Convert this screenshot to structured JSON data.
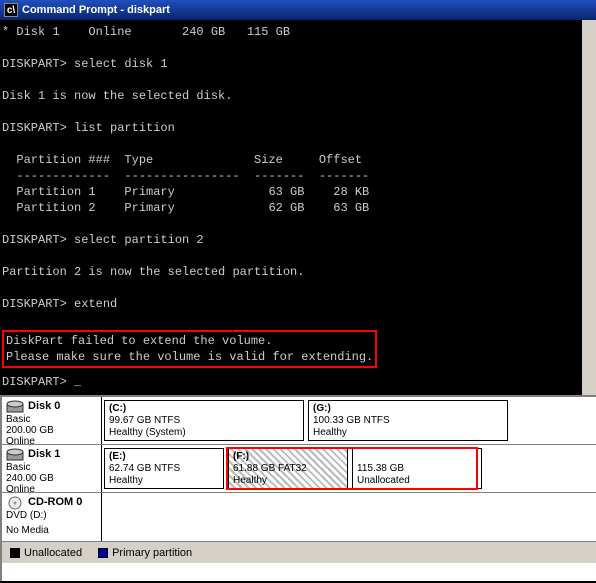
{
  "title": "Command Prompt - diskpart",
  "term": {
    "l0": "* Disk 1    Online       240 GB   115 GB",
    "p1": "DISKPART>",
    "c1": "select disk 1",
    "r1": "Disk 1 is now the selected disk.",
    "c2": "list partition",
    "th": "  Partition ###  Type              Size     Offset",
    "tr": "  -------------  ----------------  -------  -------",
    "t1": "  Partition 1    Primary             63 GB    28 KB",
    "t2": "  Partition 2    Primary             62 GB    63 GB",
    "c3": "select partition 2",
    "r3": "Partition 2 is now the selected partition.",
    "c4": "extend",
    "e1": "DiskPart failed to extend the volume.",
    "e2": "Please make sure the volume is valid for extending.",
    "cursor": "_"
  },
  "dm": {
    "d0": {
      "name": "Disk 0",
      "type": "Basic",
      "size": "200.00 GB",
      "state": "Online"
    },
    "d1": {
      "name": "Disk 1",
      "type": "Basic",
      "size": "240.00 GB",
      "state": "Online"
    },
    "cd": {
      "name": "CD-ROM 0",
      "type": "DVD (D:)",
      "media": "No Media"
    },
    "v0a": {
      "letter": "(C:)",
      "info": "99.67 GB NTFS",
      "status": "Healthy (System)"
    },
    "v0b": {
      "letter": "(G:)",
      "info": "100.33 GB NTFS",
      "status": "Healthy"
    },
    "v1a": {
      "letter": "(E:)",
      "info": "62.74 GB NTFS",
      "status": "Healthy"
    },
    "v1b": {
      "letter": "(F:)",
      "info": "61.88 GB FAT32",
      "status": "Healthy"
    },
    "v1c": {
      "info": "115.38 GB",
      "status": "Unallocated"
    },
    "legend": {
      "un": "Unallocated",
      "pp": "Primary partition"
    }
  }
}
